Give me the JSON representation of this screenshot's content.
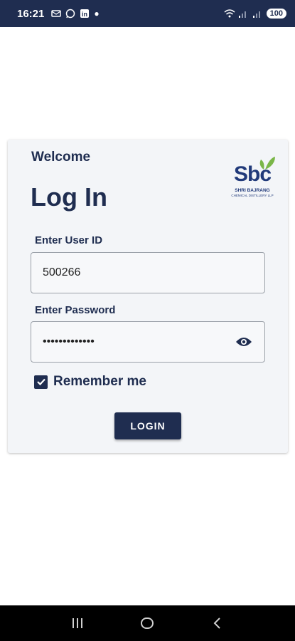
{
  "status_bar": {
    "time": "16:21",
    "battery": "100",
    "notification_icons": [
      "message-icon",
      "whatsapp-icon",
      "linkedin-icon",
      "dot-icon"
    ],
    "system_icons": [
      "wifi-icon",
      "signal-icon",
      "signal-icon"
    ]
  },
  "login_card": {
    "welcome": "Welcome",
    "title": "Log In",
    "logo": {
      "text": "Sbc",
      "line1": "SHRI BAJRANG",
      "line2": "CHEMICAL DISTILLERY LLP"
    },
    "user_id": {
      "label": "Enter User ID",
      "value": "500266"
    },
    "password": {
      "label": "Enter Password",
      "value": "•••••••••••••"
    },
    "remember_me": {
      "label": "Remember me",
      "checked": true
    },
    "login_button": "LOGIN"
  },
  "colors": {
    "primary": "#1f2d50",
    "card_bg": "#f3f5f8",
    "logo_blue": "#213a7a",
    "logo_green": "#7ab648"
  },
  "nav_bar": {
    "buttons": [
      "recents-icon",
      "home-icon",
      "back-icon"
    ]
  }
}
